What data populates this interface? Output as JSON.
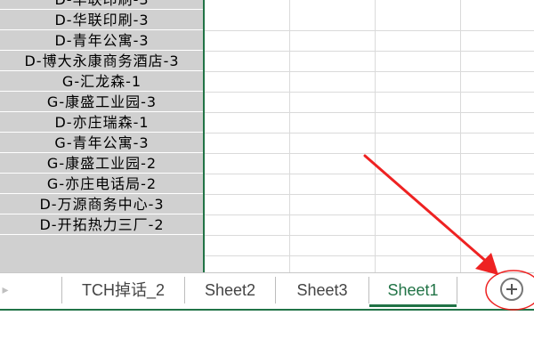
{
  "spreadsheet": {
    "column_a_cells": [
      "D-华联印刷-3",
      "D-青年公寓-3",
      "D-博大永康商务酒店-3",
      "G-汇龙森-1",
      "G-康盛工业园-3",
      "D-亦庄瑞森-1",
      "G-青年公寓-3",
      "G-康盛工业园-2",
      "G-亦庄电话局-2",
      "D-万源商务中心-3",
      "D-开拓热力三厂-2"
    ]
  },
  "sheet_tabs": {
    "scroll_left_glyph": "▸",
    "tabs": [
      {
        "label": "TCH掉话_2",
        "active": false
      },
      {
        "label": "Sheet2",
        "active": false
      },
      {
        "label": "Sheet3",
        "active": false
      },
      {
        "label": "Sheet1",
        "active": true
      }
    ],
    "add_sheet_icon": "plus-circle-icon"
  },
  "annotation": {
    "arrow_color": "#ee2222",
    "circle_color": "#ee2222"
  },
  "colors": {
    "accent": "#217346",
    "column_fill": "#d0d0d0",
    "gridline": "#dadada"
  }
}
